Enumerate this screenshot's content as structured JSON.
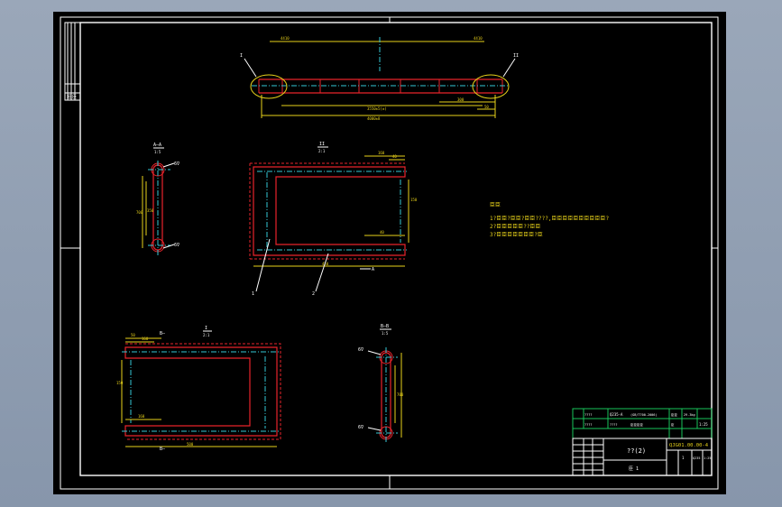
{
  "colors": {
    "background": "#000000",
    "outline": "#e8232b",
    "dimension": "#e8d21a",
    "centerline": "#33c9d6",
    "frame": "#ffffff",
    "title_block": "#19c45a"
  },
  "views": {
    "top_view": {
      "callout_left": "I",
      "callout_right": "II",
      "dim_top": "4410",
      "dim_bottom": "4000±8",
      "dim_bottom_inner": "3550±5(±)",
      "dim_right_a": "300",
      "dim_right_b": "50"
    },
    "section_aa": {
      "label": "A—A",
      "scale": "1:5",
      "dim_height": "700",
      "dim_inner": "350",
      "weld_top": "6∇",
      "weld_bottom": "6∇"
    },
    "detail_ii": {
      "label": "II",
      "scale": "2:1",
      "dim_top": "160",
      "dim_mid": "40",
      "dim_bottom": "450",
      "dim_side": "150",
      "leader_a": "A",
      "part_1": "1",
      "part_2": "2"
    },
    "detail_i": {
      "label": "I",
      "scale": "2:1",
      "dim_top_a": "50",
      "dim_top_b": "160",
      "dim_bottom": "500",
      "dim_side": "150",
      "section_mark": "B—"
    },
    "section_bb": {
      "label": "B—B",
      "scale": "1:5",
      "dim_height": "700",
      "weld_top": "6∇",
      "weld_bottom": "6∇"
    }
  },
  "notes": {
    "heading": "⾂⾂",
    "lines": [
      "1?⾂⾂?⾂⾂?⾂⾂????,⾂⾂⾂⾂⾂⾂⾂⾂⾂⾂?",
      "2?⾂⾂⾂⾂⾂??⾂⾂",
      "3?⾂⾂⾂⾂⾂⾂⾂?⾂"
    ]
  },
  "title_block": {
    "row1": [
      "????",
      "Q235-A",
      "(GB/T700-2006)",
      "⾂⾂",
      "29.3kg"
    ],
    "row2": [
      "????",
      "????",
      "⾂⾂⾂⾂",
      "⾂",
      "1:25"
    ],
    "drawing_number": "QJG01.00.00-4",
    "part_name": "??(2)",
    "sheet": "⾂ 1",
    "qty": "1",
    "material": "Q235",
    "scale": "1:25"
  },
  "side_strip": {
    "label": "⾂⾂"
  }
}
